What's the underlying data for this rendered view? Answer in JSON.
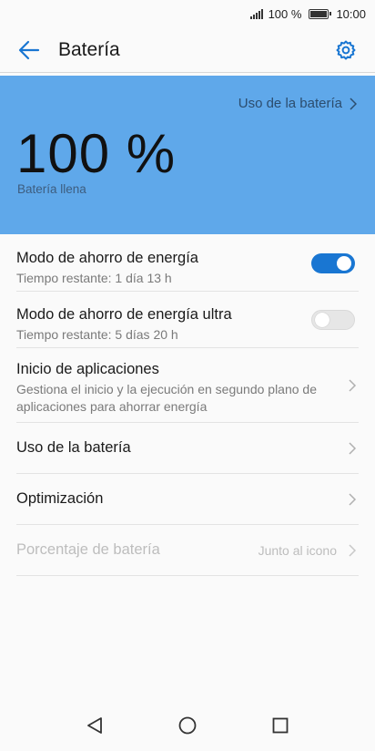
{
  "status_bar": {
    "signal_icon": "signal-icon",
    "battery_percent": "100 %",
    "battery_icon": "battery-icon",
    "time": "10:00"
  },
  "app_bar": {
    "back_icon": "arrow-left-icon",
    "title": "Batería",
    "settings_icon": "gear-icon",
    "accent": "#1976d2"
  },
  "hero": {
    "background": "#5fa8ea",
    "usage_link": "Uso de la batería",
    "percent": "100 %",
    "status": "Batería llena"
  },
  "settings": [
    {
      "title": "Modo de ahorro de energía",
      "subtitle": "Tiempo restante: 1 día 13 h",
      "toggle": true
    },
    {
      "title": "Modo de ahorro de energía ultra",
      "subtitle": "Tiempo restante: 5 días 20 h",
      "toggle": false
    },
    {
      "title": "Inicio de aplicaciones",
      "subtitle": "Gestiona el inicio y la ejecución en segundo plano de aplicaciones para ahorrar energía"
    },
    {
      "title": "Uso de la batería"
    },
    {
      "title": "Optimización"
    },
    {
      "title": "Porcentaje de batería",
      "value": "Junto al icono",
      "disabled": true
    }
  ],
  "nav_bar": {
    "back": "triangle-back-icon",
    "home": "circle-home-icon",
    "recents": "square-recents-icon"
  }
}
